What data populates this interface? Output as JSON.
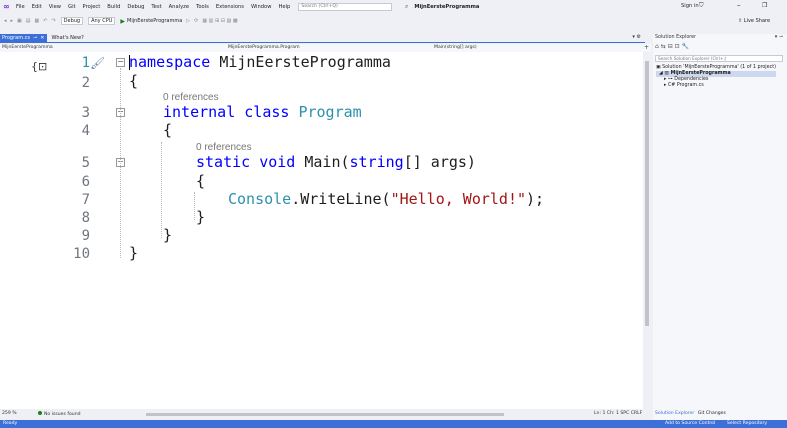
{
  "titlebar": {
    "menus": [
      "File",
      "Edit",
      "View",
      "Git",
      "Project",
      "Build",
      "Debug",
      "Test",
      "Analyze",
      "Tools",
      "Extensions",
      "Window",
      "Help"
    ],
    "search_placeholder": "Search (Ctrl+Q)",
    "solution_title": "MijnEersteProgramma",
    "sign_in": "Sign in"
  },
  "toolbar": {
    "config": "Debug",
    "platform": "Any CPU",
    "run_target": "MijnEersteProgramma",
    "live_share": "Live Share"
  },
  "tabs": {
    "active": "Program.cs",
    "other": "What's New?"
  },
  "navbar": {
    "project": "MijnEersteProgramma",
    "class": "MijnEersteProgramma.Program",
    "member": "Main(string[] args)"
  },
  "editor": {
    "line_numbers": [
      "1",
      "2",
      "3",
      "4",
      "5",
      "6",
      "7",
      "8",
      "9",
      "10"
    ],
    "references_1": "0 references",
    "references_2": "0 references",
    "line1_kw": "namespace",
    "line1_name": "MijnEersteProgramma",
    "brace_open": "{",
    "brace_close": "}",
    "line3_kw1": "internal",
    "line3_kw2": "class",
    "line3_type": "Program",
    "line5_kw1": "static",
    "line5_kw2": "void",
    "line5_method": "Main(",
    "line5_kw3": "string",
    "line5_rest": "[] args)",
    "line7_type": "Console",
    "line7_call": ".WriteLine(",
    "line7_str": "\"Hello, World!\"",
    "line7_end": ");"
  },
  "bottom": {
    "zoom": "259 %",
    "issues": "No issues found",
    "position": "Ln: 1   Ch: 1   SPC   CRLF"
  },
  "statusbar": {
    "ready": "Ready",
    "source_control": "Add to Source Control",
    "repository": "Select Repository"
  },
  "solution_explorer": {
    "title": "Solution Explorer",
    "search_placeholder": "Search Solution Explorer (Ctrl+;)",
    "solution_node": "Solution 'MijnEersteProgramma' (1 of 1 project)",
    "project_node": "MijnEersteProgramma",
    "deps_node": "Dependencies",
    "file_node": "Program.cs",
    "tab_solution": "Solution Explorer",
    "tab_git": "Git Changes"
  }
}
